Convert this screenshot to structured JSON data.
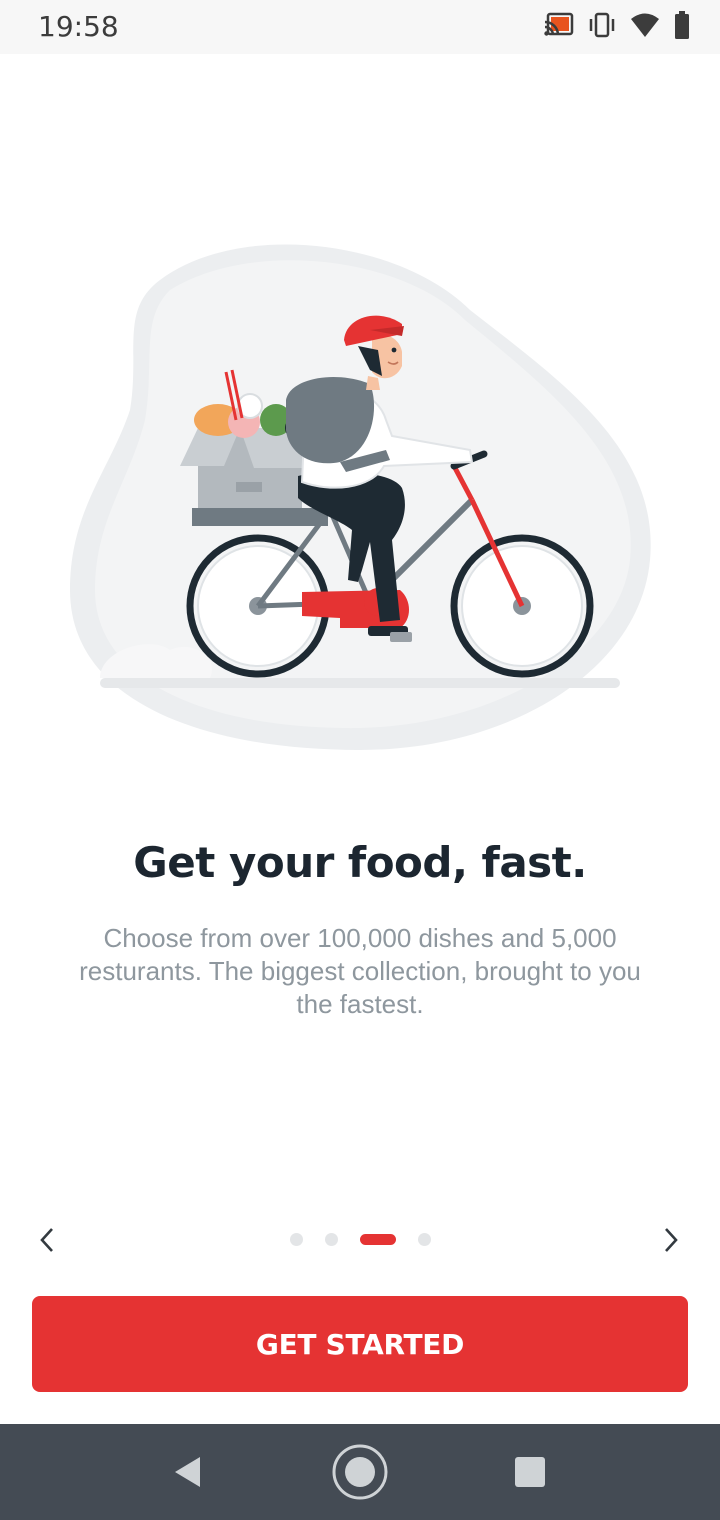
{
  "status_bar": {
    "time": "19:58",
    "icons": [
      "cast-icon",
      "vibrate-icon",
      "wifi-icon",
      "battery-icon"
    ]
  },
  "onboarding": {
    "illustration": "delivery-cyclist-illustration",
    "headline": "Get your food, fast.",
    "description": "Choose from over 100,000 dishes and 5,000 resturants. The biggest collection, brought to you the fastest.",
    "page_indicator": {
      "total": 4,
      "current": 3
    },
    "prev_icon": "chevron-left-icon",
    "next_icon": "chevron-right-icon",
    "cta_label": "GET STARTED"
  },
  "system_nav": {
    "back_icon": "back-triangle-icon",
    "home_icon": "home-circle-icon",
    "recents_icon": "recents-square-icon"
  },
  "colors": {
    "accent": "#e53333",
    "headline": "#1c2630",
    "body_text": "#8e979e",
    "nav_bar": "#444b54"
  }
}
